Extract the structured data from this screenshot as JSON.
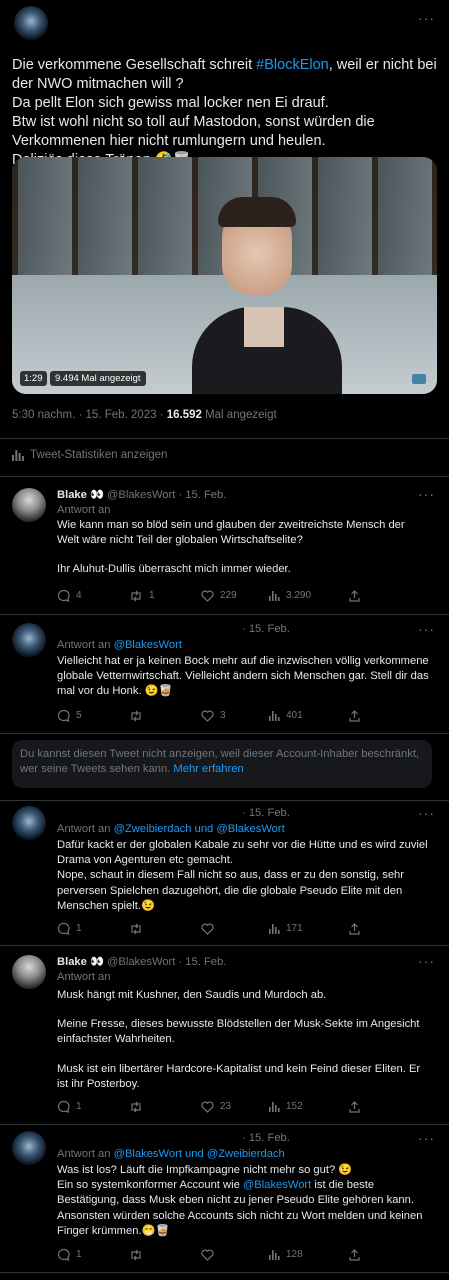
{
  "main_tweet": {
    "text_before_tag": "Die verkommene Gesellschaft schreit ",
    "hashtag": "#BlockElon",
    "text_after_tag": ", weil er nicht bei der NWO mitmachen will ?",
    "line2": "Da pellt Elon sich gewiss mal locker nen Ei drauf.",
    "line3": "Btw ist wohl nicht so toll auf Mastodon, sonst würden die Verkommenen hier nicht rumlungern und heulen.",
    "line4": "Deliziös diese Tränen.🤣🥃",
    "video_duration": "1:29",
    "video_views": "9.494 Mal angezeigt",
    "time": "5:30 nachm. · 15. Feb. 2023 · ",
    "views_count": "16.592",
    "views_label": " Mal angezeigt",
    "stats_label": "Tweet-Statistiken anzeigen",
    "more": "···"
  },
  "replies": [
    {
      "name": "Blake 👀",
      "handle": "@BlakesWort · 15. Feb.",
      "reply_prefix": "Antwort an",
      "reply_to": "",
      "reply_to2": "",
      "p1": "Wie kann man so blöd sein und glauben der zweitreichste Mensch der Welt wäre nicht Teil der globalen Wirtschaftselite?",
      "p2": "Ihr Aluhut-Dullis überrascht mich immer wieder.",
      "comments": "4",
      "retweets": "1",
      "likes": "229",
      "views": "3.290"
    },
    {
      "date": "· 15. Feb.",
      "reply_prefix": "Antwort an ",
      "reply_to": "@BlakesWort",
      "text": "Vielleicht hat er ja keinen Bock mehr auf die inzwischen völlig verkommene globale Vetternwirtschaft. Vielleicht ändern sich Menschen gar. Stell dir das mal vor du Honk. 😉🥃",
      "comments": "5",
      "retweets": "",
      "likes": "3",
      "views": "401"
    },
    {
      "date": "· 15. Feb.",
      "reply_prefix": "Antwort an ",
      "reply_to": "@Zweibierdach",
      "and": " und ",
      "reply_to2": "@BlakesWort",
      "text": "Dafür kackt er der globalen Kabale zu sehr vor die Hütte und es wird zuviel Drama von Agenturen etc gemacht.\nNope, schaut in diesem Fall nicht so aus, dass er zu den sonstig, sehr perversen Spielchen dazugehört, die die globale Pseudo Elite mit den Menschen spielt.😉",
      "comments": "1",
      "retweets": "",
      "likes": "",
      "views": "171"
    },
    {
      "name": "Blake 👀",
      "handle": "@BlakesWort · 15. Feb.",
      "reply_prefix": "Antwort an",
      "p1": "Musk hängt mit Kushner, den Saudis und Murdoch ab.",
      "p2": "Meine Fresse, dieses bewusste Blödstellen der Musk-Sekte im Angesicht einfachster Wahrheiten.",
      "p3": "Musk ist ein libertärer Hardcore-Kapitalist und kein Feind dieser Eliten. Er ist ihr Posterboy.",
      "comments": "1",
      "retweets": "",
      "likes": "23",
      "views": "152"
    },
    {
      "date": "· 15. Feb.",
      "reply_prefix": "Antwort an ",
      "reply_to": "@BlakesWort",
      "and": " und ",
      "reply_to2": "@Zweibierdach",
      "text_a": "Was ist los? Läuft die Impfkampagne nicht mehr so gut? 😉",
      "text_b_pre": "Ein so systemkonformer Account wie ",
      "text_b_link": "@BlakesWort",
      "text_b_post": " ist die beste Bestätigung, dass Musk eben nicht zu jener Pseudo Elite gehören kann. Ansonsten würden solche Accounts sich nicht zu Wort melden und keinen Finger krümmen.😁🥃",
      "comments": "1",
      "retweets": "",
      "likes": "",
      "views": "128"
    }
  ],
  "hidden_notice": {
    "text": "Du kannst diesen Tweet nicht anzeigen, weil dieser Account-Inhaber beschränkt, wer seine Tweets sehen kann. ",
    "link": "Mehr erfahren"
  },
  "colors": {
    "accent": "#1d9bf0",
    "muted": "#71767b",
    "text": "#e7e9ea",
    "background": "#000000"
  }
}
